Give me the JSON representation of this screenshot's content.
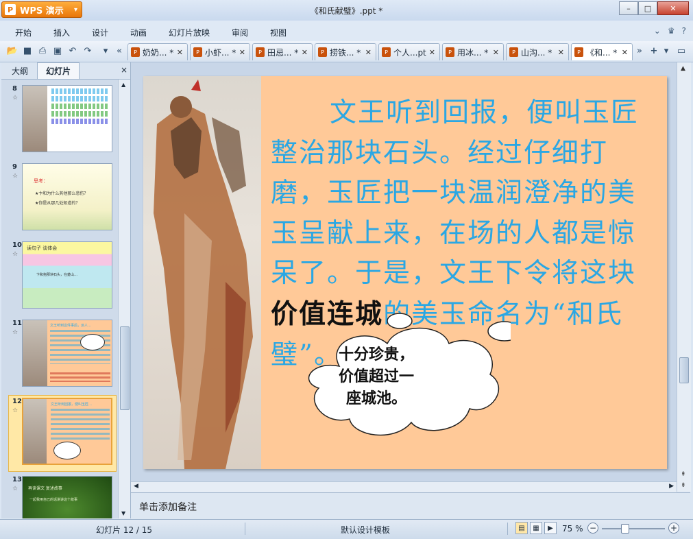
{
  "app": {
    "logo_label": "WPS 演示",
    "window_title": "《和氏献璧》.ppt *"
  },
  "menu": [
    "开始",
    "插入",
    "设计",
    "动画",
    "幻灯片放映",
    "审阅",
    "视图"
  ],
  "doc_tabs": [
    {
      "label": "奶奶... *"
    },
    {
      "label": "小虾... *"
    },
    {
      "label": "田忌... *"
    },
    {
      "label": "捞铁... *"
    },
    {
      "label": "个人...pt"
    },
    {
      "label": "用冰... *"
    },
    {
      "label": "山沟... *"
    },
    {
      "label": "《和... *"
    }
  ],
  "left_panel": {
    "tab_outline": "大纲",
    "tab_slides": "幻灯片",
    "close": "×"
  },
  "thumbnails": [
    {
      "num": "8",
      "title": "",
      "lines": [
        "…"
      ]
    },
    {
      "num": "9",
      "title": "思考：",
      "lines": [
        "★卞和为什么其他那么悲伤？",
        "★你是从那几处知道的？"
      ]
    },
    {
      "num": "10",
      "title": "读句子  谈体会",
      "lines": [
        "卞和抱那块石头，在楚山…"
      ]
    },
    {
      "num": "11",
      "title": "",
      "lines": [
        "文王听到这件事后，派人…"
      ]
    },
    {
      "num": "12",
      "title": "",
      "lines": [
        "文王听到回报，便叫玉匠…"
      ]
    },
    {
      "num": "13",
      "title": "再读课文  复述故事",
      "lines": [
        "一起我用自己的话讲讲这个故事"
      ]
    }
  ],
  "slide": {
    "text_before": "文王听到回报，便叫玉匠整治那块石头。经过仔细打磨，玉匠把一块温润澄净的美玉呈献上来，在场的人都是惊呆了。于是，文王下令将这块",
    "text_bold": "价值连城",
    "text_after": "的美玉命名为“和氏璧”。",
    "bubble_text": [
      "十分珍贵，",
      "价值超过一",
      "座城池。"
    ]
  },
  "notes_placeholder": "单击添加备注",
  "status": {
    "slide_counter": "幻灯片 12 / 15",
    "template": "默认设计模板",
    "zoom": "75 %"
  },
  "colors": {
    "slide_bg": "#ffc998",
    "slide_text": "#2aa7e4",
    "app_orange": "#e8760a"
  }
}
